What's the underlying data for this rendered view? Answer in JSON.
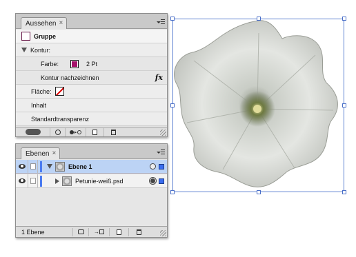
{
  "appearance_panel": {
    "tab_label": "Aussehen",
    "tab_close": "×",
    "window_minimize": "–",
    "window_close": "×",
    "group_label": "Gruppe",
    "stroke": {
      "label": "Kontur:",
      "color_label": "Farbe:",
      "color": "#a5126a",
      "weight": "2 Pt",
      "trace_label": "Kontur nachzeichnen",
      "fx_label": "fx"
    },
    "fill_label": "Fläche:",
    "content_label": "Inhalt",
    "transparency_label": "Standardtransparenz"
  },
  "layers_panel": {
    "tab_label": "Ebenen",
    "tab_close": "×",
    "layers": [
      {
        "name": "Ebene 1",
        "expanded": true,
        "selected": true,
        "color": "#4a7bf0"
      },
      {
        "name": "Petunie-weiß.psd",
        "expanded": false,
        "selected": false,
        "color": "#4a7bf0"
      }
    ],
    "status": "1 Ebene"
  },
  "canvas": {
    "object": "petunia-photo",
    "selection_color": "#4a6fc8"
  }
}
